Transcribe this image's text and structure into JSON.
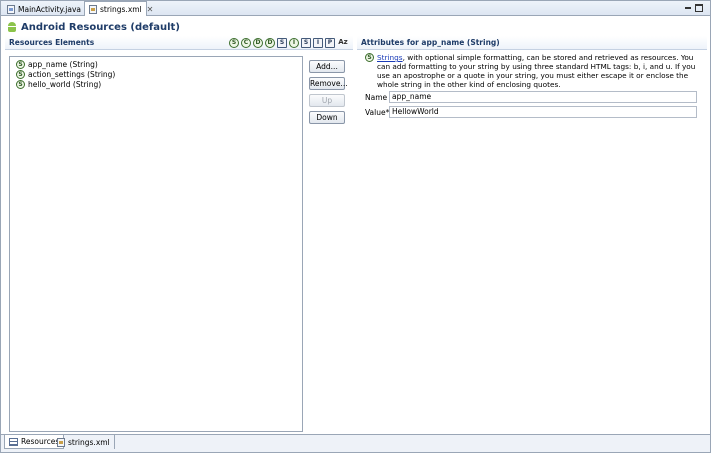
{
  "tabs": [
    {
      "label": "MainActivity.java",
      "icon": "java-file-icon"
    },
    {
      "label": "strings.xml",
      "icon": "xml-file-icon"
    }
  ],
  "header": {
    "title": "Android Resources (default)",
    "icon": "android-icon"
  },
  "resources": {
    "title": "Resources Elements",
    "type_buttons": [
      "S",
      "C",
      "D",
      "D",
      "S",
      "I",
      "S",
      "I",
      "P",
      "Az"
    ],
    "items": [
      "app_name (String)",
      "action_settings (String)",
      "hello_world (String)"
    ],
    "buttons": {
      "add": "Add...",
      "remove": "Remove...",
      "up": "Up",
      "down": "Down"
    }
  },
  "attributes": {
    "title": "Attributes for app_name (String)",
    "desc_link": "Strings",
    "desc_text": ", with optional simple formatting, can be stored and retrieved as resources. You can add formatting to your string by using three standard HTML tags: b, i, and u. If you use an apostrophe or a quote in your string, you must either escape it or enclose the whole string in the other kind of enclosing quotes.",
    "name_label": "Name",
    "name_value": "app_name",
    "value_label": "Value*",
    "value_value": "HellowWorld"
  },
  "bottom_tabs": [
    {
      "label": "Resources",
      "icon": "grid-icon"
    },
    {
      "label": "strings.xml",
      "icon": "xml-file-icon"
    }
  ],
  "colors": {
    "section_title": "#1f3c68",
    "link": "#1a3bb8",
    "string_icon": "#3c6e2c"
  }
}
